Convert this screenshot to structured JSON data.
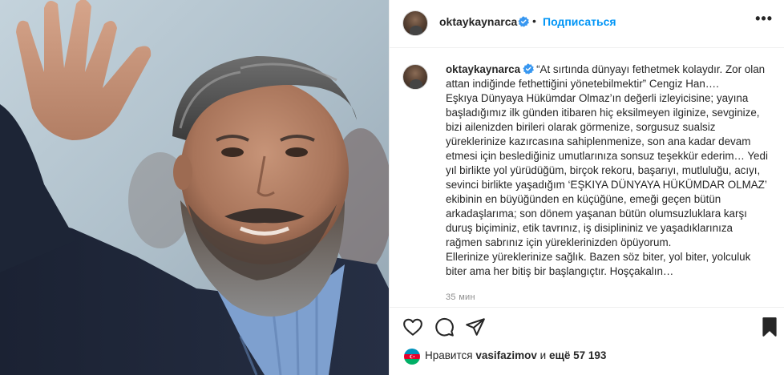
{
  "post": {
    "username": "oktaykaynarca",
    "follow_label": "Подписаться",
    "separator": "•",
    "more_label": "•••",
    "caption_username": "oktaykaynarca",
    "caption_lines": [
      "“At sırtında dünyayı fethetmek kolaydır. Zor olan attan indiğinde fethettiğini yönetebilmektir” Cengiz Han….",
      "Eşkıya Dünyaya Hükümdar Olmaz’ın değerli izleyicisine; yayına başladığımız ilk günden itibaren hiç eksilmeyen ilginize, sevginize, bizi ailenizden birileri olarak görmenize, sorgusuz sualsiz yüreklerinize kazırcasına sahiplenmenize, son ana kadar devam etmesi için beslediğiniz umutlarınıza sonsuz teşekkür ederim… Yedi yıl birlikte yol yürüdüğüm, birçok rekoru, başarıyı, mutluluğu, acıyı, sevinci birlikte yaşadığım ‘EŞKIYA DÜNYAYA HÜKÜMDAR OLMAZ’ ekibinin en büyüğünden en küçüğüne, emeği geçen bütün arkadaşlarıma; son dönem yaşanan bütün olumsuzluklara karşı duruş biçiminiz, etik tavrınız, iş disiplininiz ve yaşadıklarınıza rağmen sabrınız için yüreklerinizden öpüyorum.",
      "Ellerinize yüreklerinize sağlık. Bazen söz biter, yol biter, yolculuk biter ama her bitiş bir başlangıçtır. Hoşçakalın…"
    ],
    "time_ago": "35 мин",
    "likes_prefix": "Нравится",
    "liked_by": "vasifazimov",
    "likes_conjunction": "и",
    "likes_rest": "ещё 57 193"
  },
  "colors": {
    "accent": "#0095f6",
    "verified": "#3897f0",
    "text": "#262626",
    "muted": "#8e8e8e",
    "border": "#efefef"
  },
  "icons": {
    "like": "heart-icon",
    "comment": "comment-icon",
    "share": "paper-plane-icon",
    "save": "bookmark-icon",
    "verified": "verified-badge-icon",
    "liker_avatar": "azerbaijan-flag-icon"
  }
}
